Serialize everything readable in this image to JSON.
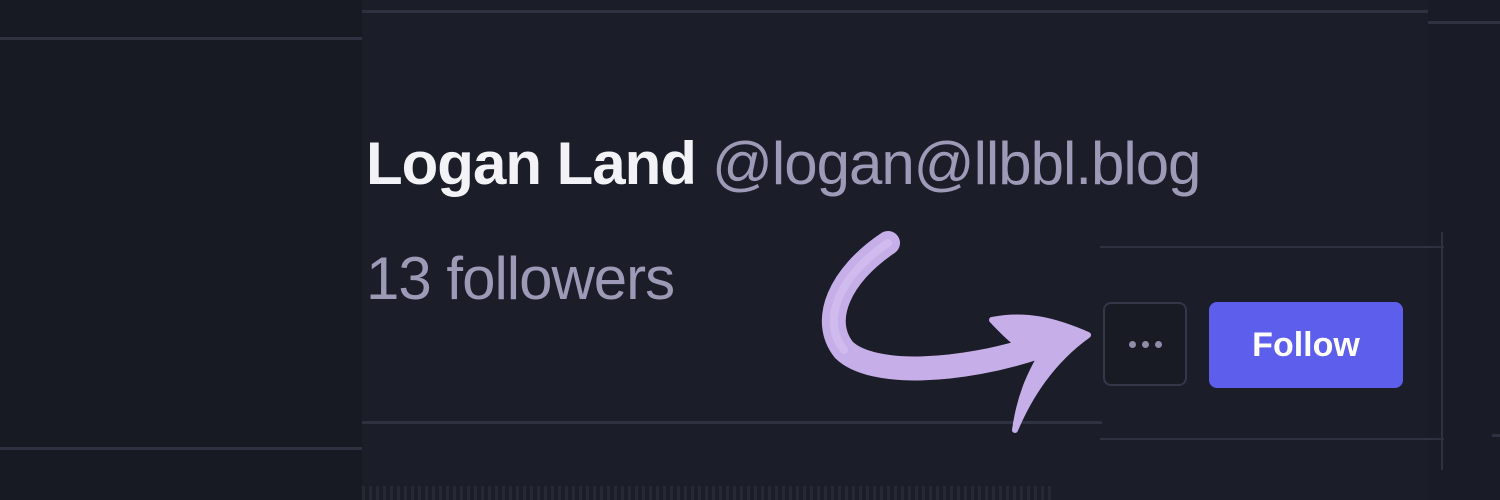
{
  "profile": {
    "display_name": "Logan Land",
    "handle": "@logan@llbbl.blog",
    "followers_text": "13 followers"
  },
  "actions": {
    "more_icon": "ellipsis-icon",
    "follow_label": "Follow"
  },
  "annotation": {
    "arrow_icon": "curved-arrow-icon",
    "arrow_color": "#c6aee8"
  },
  "colors": {
    "background": "#191b27",
    "accent": "#5e5eec",
    "muted_text": "#9d9ab8",
    "primary_text": "#f2f2f7"
  }
}
